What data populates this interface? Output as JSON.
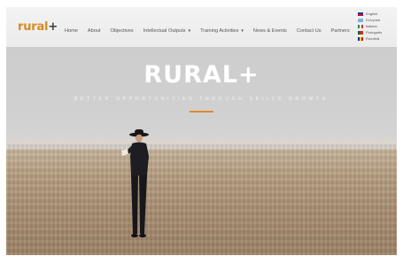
{
  "logo": {
    "text": "rural",
    "plus": "+"
  },
  "nav": {
    "items": [
      {
        "label": "Home"
      },
      {
        "label": "About"
      },
      {
        "label": "Objectives"
      },
      {
        "label": "Intellectual Outputs",
        "caret": "▾"
      },
      {
        "label": "Training Activities",
        "caret": "▾"
      },
      {
        "label": "News & Events"
      },
      {
        "label": "Contact Us"
      },
      {
        "label": "Partners"
      }
    ]
  },
  "languages": [
    {
      "label": "English",
      "colors": [
        "#1f3b8a",
        "#c8102e"
      ]
    },
    {
      "label": "Ελληνικά",
      "colors": [
        "#0d5eaf",
        "#ffffff"
      ]
    },
    {
      "label": "Italiano",
      "colors": [
        "#009246",
        "#ce2b37"
      ]
    },
    {
      "label": "Português",
      "colors": [
        "#046a38",
        "#da291c"
      ]
    },
    {
      "label": "Română",
      "colors": [
        "#002b7f",
        "#fcd116"
      ]
    }
  ],
  "hero": {
    "title": "RURAL+",
    "subtitle": "BETTER OPPORTUNITIES THROUGH SKILLS GROWTH"
  },
  "colors": {
    "accent": "#e0892b",
    "logo": "#d98a1f"
  }
}
